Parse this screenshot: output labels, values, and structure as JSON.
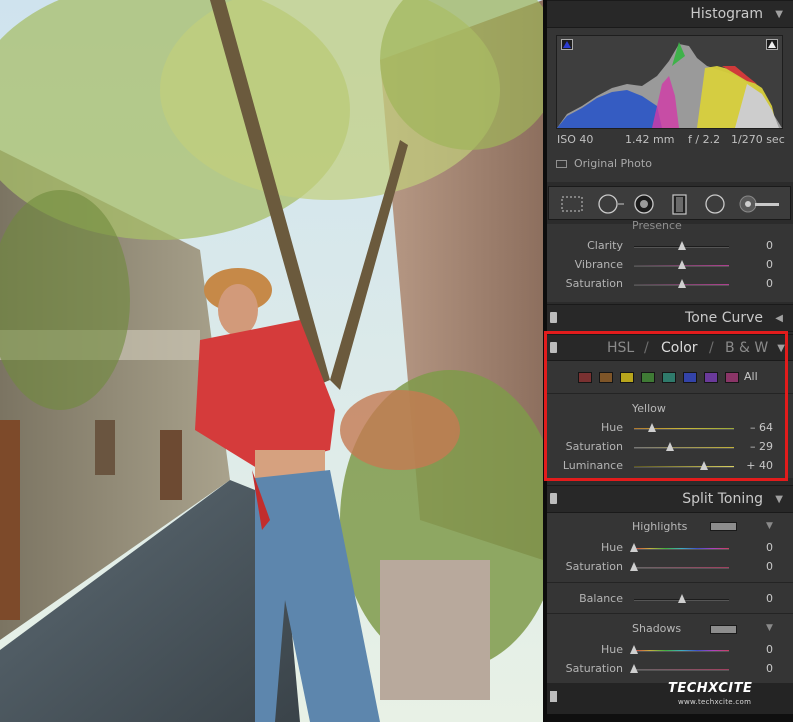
{
  "histogram": {
    "title": "Histogram",
    "iso": "ISO 40",
    "focal": "1.42 mm",
    "aperture": "f / 2.2",
    "shutter": "1/270 sec",
    "original_photo_label": "Original Photo"
  },
  "presence": {
    "title": "Presence",
    "rows": [
      {
        "label": "Clarity",
        "value": "0",
        "pos": 0.5
      },
      {
        "label": "Vibrance",
        "value": "0",
        "pos": 0.5
      },
      {
        "label": "Saturation",
        "value": "0",
        "pos": 0.5
      }
    ]
  },
  "tone_curve": {
    "title": "Tone Curve"
  },
  "hsl": {
    "tab_hsl": "HSL",
    "tab_color": "Color",
    "tab_bw": "B & W",
    "sep": "/",
    "all_label": "All",
    "chip_colors": [
      "#7a3131",
      "#7e5528",
      "#b8a51c",
      "#3f7a35",
      "#2f7a6b",
      "#3343a8",
      "#6a3a9a",
      "#8a3567"
    ],
    "selected_color": "Yellow",
    "rows": [
      {
        "label": "Hue",
        "value": "– 64",
        "pos": 0.18
      },
      {
        "label": "Saturation",
        "value": "– 29",
        "pos": 0.36
      },
      {
        "label": "Luminance",
        "value": "+ 40",
        "pos": 0.7
      }
    ]
  },
  "split_toning": {
    "title": "Split Toning",
    "highlights_label": "Highlights",
    "highlights": [
      {
        "label": "Hue",
        "value": "0",
        "pos": 0.0
      },
      {
        "label": "Saturation",
        "value": "0",
        "pos": 0.0
      }
    ],
    "balance": {
      "label": "Balance",
      "value": "0",
      "pos": 0.5
    },
    "shadows_label": "Shadows",
    "shadows": [
      {
        "label": "Hue",
        "value": "0",
        "pos": 0.0
      },
      {
        "label": "Saturation",
        "value": "0",
        "pos": 0.0
      }
    ]
  },
  "watermark": {
    "brand": "TECHXCITE",
    "url": "www.techxcite.com"
  },
  "colors": {
    "highlight_box": "#e21c1c",
    "panel_bg": "#2b2b2b"
  }
}
